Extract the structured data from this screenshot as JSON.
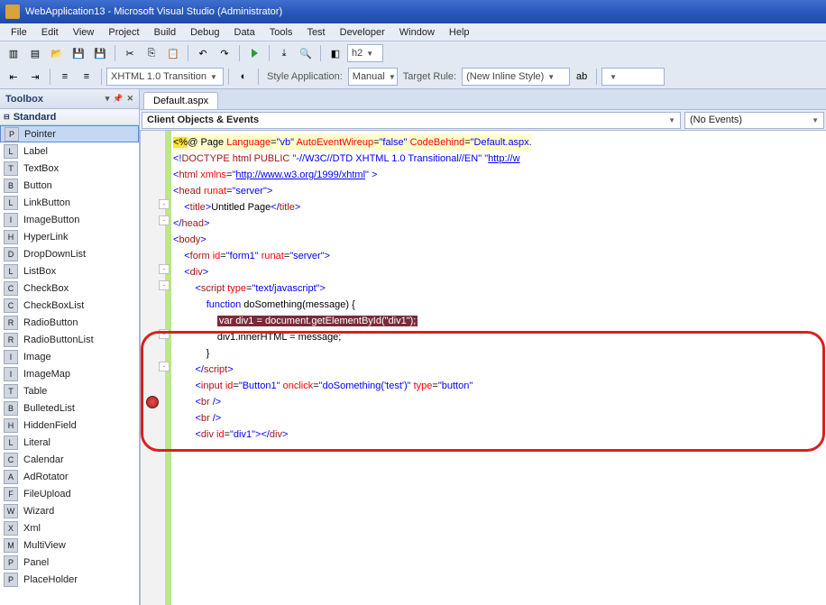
{
  "title": "WebApplication13 - Microsoft Visual Studio (Administrator)",
  "menu": [
    "File",
    "Edit",
    "View",
    "Project",
    "Build",
    "Debug",
    "Data",
    "Tools",
    "Test",
    "Developer",
    "Window",
    "Help"
  ],
  "row1": {
    "doctype": "XHTML 1.0 Transition"
  },
  "row2": {
    "styleapp_label": "Style Application:",
    "styleapp_val": "Manual",
    "target_label": "Target Rule:",
    "target_val": "(New Inline Style)",
    "run_target": "h2"
  },
  "toolbox": {
    "title": "Toolbox",
    "cat": "Standard",
    "items": [
      "Pointer",
      "Label",
      "TextBox",
      "Button",
      "LinkButton",
      "ImageButton",
      "HyperLink",
      "DropDownList",
      "ListBox",
      "CheckBox",
      "CheckBoxList",
      "RadioButton",
      "RadioButtonList",
      "Image",
      "ImageMap",
      "Table",
      "BulletedList",
      "HiddenField",
      "Literal",
      "Calendar",
      "AdRotator",
      "FileUpload",
      "Wizard",
      "Xml",
      "MultiView",
      "Panel",
      "PlaceHolder"
    ],
    "selected": 0
  },
  "editor": {
    "tab": "Default.aspx",
    "obj": "Client Objects & Events",
    "evt": "(No Events)",
    "lines": [
      {
        "t": "page",
        "raw": "<%@ Page Language=\"vb\" AutoEventWireup=\"false\" CodeBehind=\"Default.aspx."
      },
      {
        "t": "blank"
      },
      {
        "t": "doctype",
        "raw": "<!DOCTYPE html PUBLIC \"-//W3C//DTD XHTML 1.0 Transitional//EN\" \"http://w"
      },
      {
        "t": "blank"
      },
      {
        "t": "html_open",
        "xmlns": "http://www.w3.org/1999/xhtml"
      },
      {
        "t": "head_open",
        "runat": "server"
      },
      {
        "t": "title",
        "text": "Untitled Page"
      },
      {
        "t": "head_close"
      },
      {
        "t": "body_open"
      },
      {
        "t": "form_open",
        "id": "form1",
        "runat": "server"
      },
      {
        "t": "div_open"
      },
      {
        "t": "blank"
      },
      {
        "t": "script_open",
        "type": "text/javascript"
      },
      {
        "t": "blank"
      },
      {
        "t": "fn",
        "sig": "function doSomething(message) {"
      },
      {
        "t": "blank"
      },
      {
        "t": "bp",
        "code": "var div1 = document.getElementById(\"div1\");"
      },
      {
        "t": "blank"
      },
      {
        "t": "stmt",
        "code": "div1.innerHTML = message;"
      },
      {
        "t": "fn_close",
        "code": "}"
      },
      {
        "t": "blank"
      },
      {
        "t": "script_close"
      },
      {
        "t": "blank"
      },
      {
        "t": "blank"
      },
      {
        "t": "input",
        "id": "Button1",
        "onclick": "doSomething('test')",
        "type": "button"
      },
      {
        "t": "blank"
      },
      {
        "t": "br"
      },
      {
        "t": "br"
      },
      {
        "t": "blank"
      },
      {
        "t": "div_id",
        "id": "div1"
      }
    ]
  }
}
